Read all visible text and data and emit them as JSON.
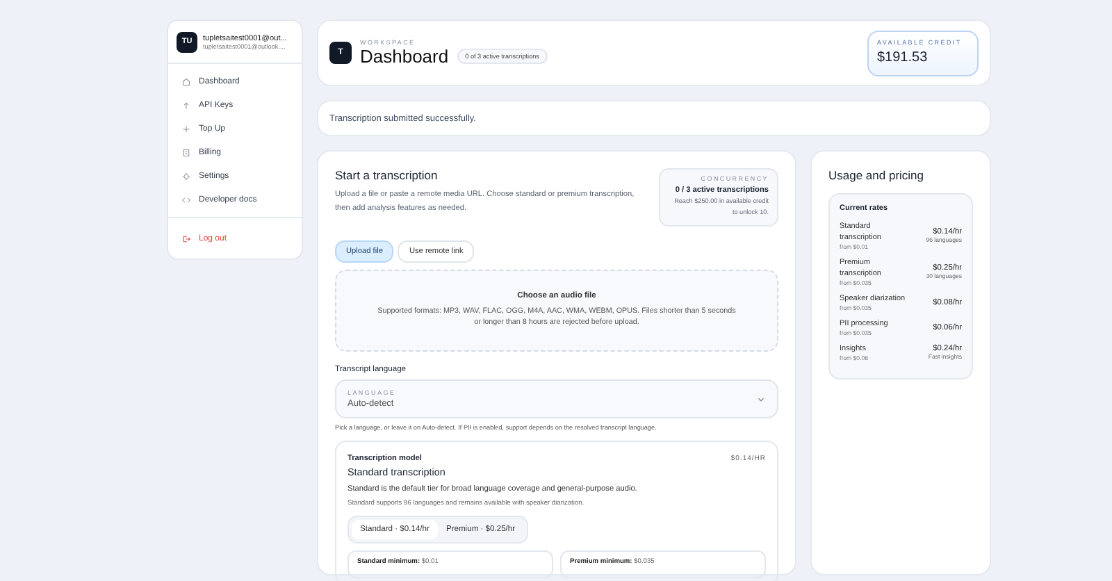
{
  "sidebar": {
    "account": {
      "initials": "TU",
      "name": "tupletsaitest0001@out...",
      "email": "tupletsaitest0001@outlook...."
    },
    "items": [
      {
        "label": "Dashboard"
      },
      {
        "label": "API Keys"
      },
      {
        "label": "Top Up"
      },
      {
        "label": "Billing"
      },
      {
        "label": "Settings"
      },
      {
        "label": "Developer docs"
      }
    ],
    "logout": "Log out"
  },
  "header": {
    "logo": "T",
    "eyebrow": "WORKSPACE",
    "title": "Dashboard",
    "badge": "0 of 3 active transcriptions",
    "credit_label": "AVAILABLE CREDIT",
    "credit": "$191.53"
  },
  "notice": "Transcription submitted successfully.",
  "start": {
    "title": "Start a transcription",
    "description": "Upload a file or paste a remote media URL. Choose standard or premium transcription, then add analysis features as needed.",
    "concurrency": {
      "label": "CONCURRENCY",
      "value": "0 / 3 active transcriptions",
      "note": "Reach $250.00 in available credit to unlock 10."
    },
    "modes": [
      {
        "label": "Upload file",
        "selected": true
      },
      {
        "label": "Use remote link",
        "selected": false
      }
    ],
    "dropzone": {
      "title": "Choose an audio file",
      "text": "Supported formats: MP3, WAV, FLAC, OGG, M4A, AAC, WMA, WEBM, OPUS. Files shorter than 5 seconds or longer than 8 hours are rejected before upload."
    },
    "language": {
      "heading": "Transcript language",
      "label": "LANGUAGE",
      "value": "Auto-detect",
      "help": "Pick a language, or leave it on Auto-detect. If PII is enabled, support depends on the resolved transcript language."
    },
    "model": {
      "label": "Transcription model",
      "price": "$0.14/HR",
      "name": "Standard transcription",
      "description": "Standard is the default tier for broad language coverage and general-purpose audio.",
      "note": "Standard supports 96 languages and remains available with speaker diarization.",
      "options": [
        {
          "label": "Standard · $0.14/hr",
          "selected": true
        },
        {
          "label": "Premium · $0.25/hr",
          "selected": false
        }
      ],
      "minimums": [
        {
          "label": "Standard minimum:",
          "value": "$0.01"
        },
        {
          "label": "Premium minimum:",
          "value": "$0.035"
        }
      ]
    }
  },
  "pricing": {
    "title": "Usage and pricing",
    "rates_title": "Current rates",
    "rates": [
      {
        "name": "Standard transcription",
        "from": "from $0.01",
        "price": "$0.14/hr",
        "note": "96 languages"
      },
      {
        "name": "Premium transcription",
        "from": "from $0.035",
        "price": "$0.25/hr",
        "note": "30 languages"
      },
      {
        "name": "Speaker diarization",
        "from": "from $0.035",
        "price": "$0.08/hr"
      },
      {
        "name": "PII processing",
        "from": "from $0.035",
        "price": "$0.06/hr"
      },
      {
        "name": "Insights",
        "from": "from $0.08",
        "price": "$0.24/hr",
        "note": "Fast insights"
      }
    ]
  }
}
